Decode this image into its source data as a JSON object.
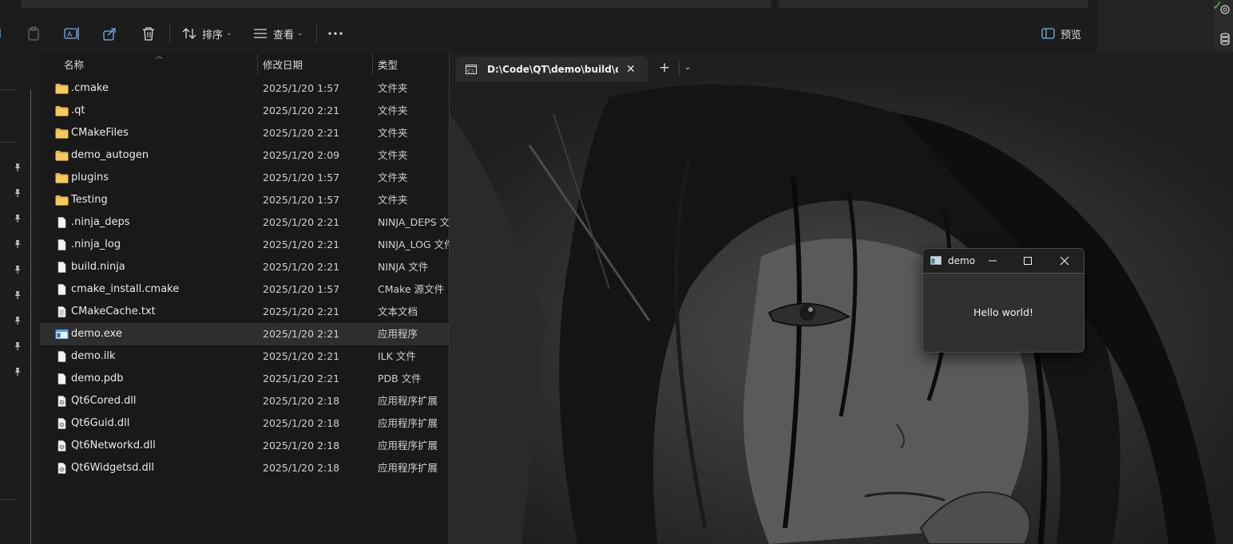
{
  "explorer": {
    "toolbar": {
      "sort_label": "排序",
      "view_label": "查看",
      "preview_label": "预览"
    },
    "columns": {
      "name": "名称",
      "date": "修改日期",
      "type": "类型"
    },
    "files": [
      {
        "name": ".cmake",
        "date": "2025/1/20 1:57",
        "type": "文件夹",
        "kind": "folder"
      },
      {
        "name": ".qt",
        "date": "2025/1/20 2:21",
        "type": "文件夹",
        "kind": "folder"
      },
      {
        "name": "CMakeFiles",
        "date": "2025/1/20 2:21",
        "type": "文件夹",
        "kind": "folder"
      },
      {
        "name": "demo_autogen",
        "date": "2025/1/20 2:09",
        "type": "文件夹",
        "kind": "folder"
      },
      {
        "name": "plugins",
        "date": "2025/1/20 1:57",
        "type": "文件夹",
        "kind": "folder"
      },
      {
        "name": "Testing",
        "date": "2025/1/20 1:57",
        "type": "文件夹",
        "kind": "folder"
      },
      {
        "name": ".ninja_deps",
        "date": "2025/1/20 2:21",
        "type": "NINJA_DEPS 文",
        "kind": "file"
      },
      {
        "name": ".ninja_log",
        "date": "2025/1/20 2:21",
        "type": "NINJA_LOG 文件",
        "kind": "file"
      },
      {
        "name": "build.ninja",
        "date": "2025/1/20 2:21",
        "type": "NINJA 文件",
        "kind": "file"
      },
      {
        "name": "cmake_install.cmake",
        "date": "2025/1/20 1:57",
        "type": "CMake 源文件",
        "kind": "file"
      },
      {
        "name": "CMakeCache.txt",
        "date": "2025/1/20 2:21",
        "type": "文本文档",
        "kind": "text"
      },
      {
        "name": "demo.exe",
        "date": "2025/1/20 2:21",
        "type": "应用程序",
        "kind": "exe",
        "selected": true
      },
      {
        "name": "demo.ilk",
        "date": "2025/1/20 2:21",
        "type": "ILK 文件",
        "kind": "file"
      },
      {
        "name": "demo.pdb",
        "date": "2025/1/20 2:21",
        "type": "PDB 文件",
        "kind": "file"
      },
      {
        "name": "Qt6Cored.dll",
        "date": "2025/1/20 2:18",
        "type": "应用程序扩展",
        "kind": "dll"
      },
      {
        "name": "Qt6Guid.dll",
        "date": "2025/1/20 2:18",
        "type": "应用程序扩展",
        "kind": "dll"
      },
      {
        "name": "Qt6Networkd.dll",
        "date": "2025/1/20 2:18",
        "type": "应用程序扩展",
        "kind": "dll"
      },
      {
        "name": "Qt6Widgetsd.dll",
        "date": "2025/1/20 2:18",
        "type": "应用程序扩展",
        "kind": "dll"
      }
    ]
  },
  "terminal": {
    "tab_title": "D:\\Code\\QT\\demo\\build\\demo.exe"
  },
  "demo_window": {
    "title": "demo",
    "message": "Hello world!"
  },
  "colors": {
    "folder": "#e8b74a",
    "accent_blue": "#4a9fe8"
  }
}
